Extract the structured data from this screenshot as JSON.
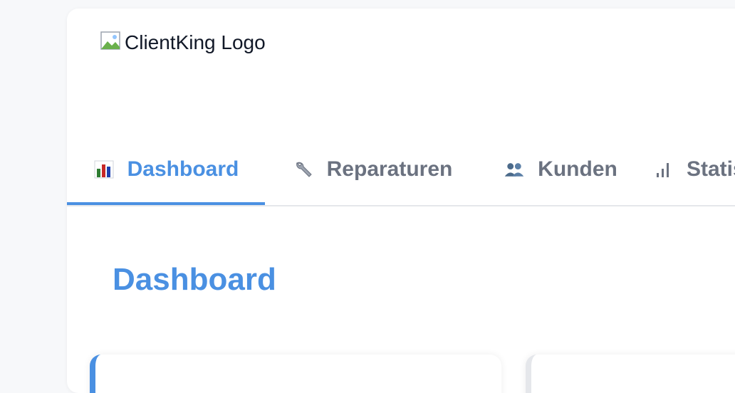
{
  "app": {
    "logo_alt": "ClientKing Logo"
  },
  "tabs": [
    {
      "label": "Dashboard",
      "icon": "bar-chart-icon",
      "active": true
    },
    {
      "label": "Reparaturen",
      "icon": "wrench-icon",
      "active": false
    },
    {
      "label": "Kunden",
      "icon": "users-icon",
      "active": false
    },
    {
      "label": "Statistiken",
      "icon": "signal-bars-icon",
      "active": false
    }
  ],
  "main": {
    "title": "Dashboard"
  },
  "colors": {
    "accent": "#4a90e2",
    "inactive_tab": "#6b7280",
    "background": "#f7f8fa"
  }
}
